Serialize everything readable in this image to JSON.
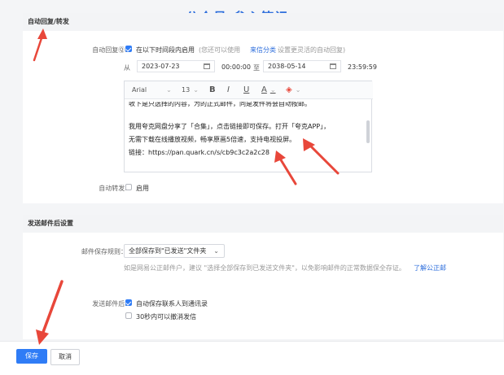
{
  "watermark": "公众号:叁心笔记",
  "auto_reply_section": {
    "title": "自动回复/转发",
    "auto_reply_label": "自动回复",
    "enable_label": "在以下时间段内启用",
    "enable_hint": "(您还可以使用",
    "category_link": "来信分类",
    "enable_hint2": "设置更灵活的自动回复)",
    "from_label": "从",
    "start_date": "2023-07-23",
    "start_time": "00:00:00",
    "to_label": "至",
    "end_date": "2038-05-14",
    "end_time": "23:59:59",
    "toolbar": {
      "font": "Arial",
      "size": "13",
      "bold": "B",
      "italic": "I",
      "underline": "U",
      "color": "A",
      "highlight": "◈"
    },
    "content": {
      "line1": "收下是只选择的内容，为的正式邮件，同是发件将会自动按邮。",
      "line2": "我用夸克网盘分享了「合集」，点击链接即可保存。打开「夸克APP」，",
      "line3": "无需下载在线播放视频，畅享原画5倍速，支持电视投屏。",
      "line4": "链接：https://pan.quark.cn/s/cb9c3c2a2c28"
    },
    "forward_label": "自动转发:",
    "forward_enable": "启用"
  },
  "after_send_section": {
    "title": "发送邮件后设置",
    "save_rule_label": "邮件保存规则：",
    "save_rule_value": "全部保存到\"已发送\"文件夹",
    "note": "如是网易公正邮件户，建议 \"选择全部保存到已发送文件夹\"，以免影响邮件的正常数据保全存证。",
    "note_link": "了解公正邮",
    "after_send_label": "发送邮件后:",
    "option1": "自动保存联系人到通讯录",
    "option2": "30秒内可以撤消发信"
  },
  "footer": {
    "save": "保存",
    "cancel": "取消"
  },
  "colors": {
    "accent": "#2f7cf6",
    "annotation": "#e8473a"
  }
}
